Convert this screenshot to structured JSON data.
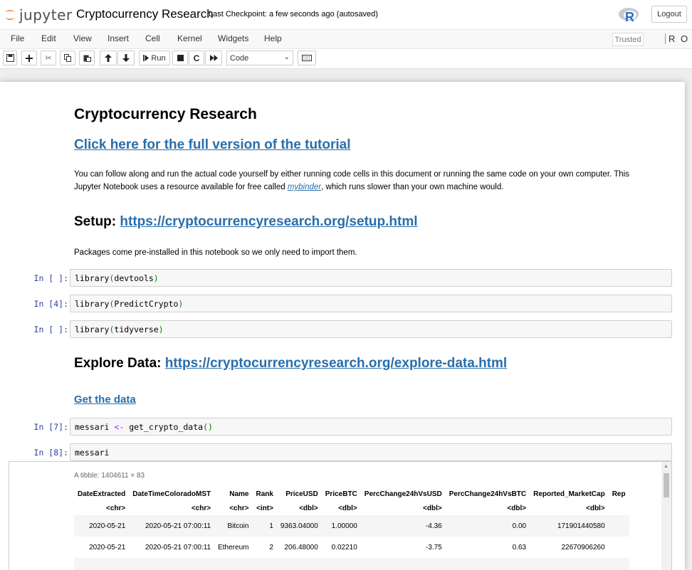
{
  "header": {
    "logo_text": "jupyter",
    "notebook_name": "Cryptocurrency Research",
    "checkpoint": "Last Checkpoint: a few seconds ago  (autosaved)",
    "kernel_logo": "R",
    "logout_label": "Logout"
  },
  "menubar": {
    "items": [
      "File",
      "Edit",
      "View",
      "Insert",
      "Cell",
      "Kernel",
      "Widgets",
      "Help"
    ],
    "trusted_label": "Trusted",
    "kernel_indicator": "R O"
  },
  "toolbar": {
    "run_label": "Run",
    "cell_type": "Code",
    "icons": [
      "save-icon",
      "plus-icon",
      "cut-icon",
      "copy-icon",
      "paste-icon",
      "arrow-up-icon",
      "arrow-down-icon",
      "run-icon",
      "stop-icon",
      "restart-icon",
      "fast-forward-icon",
      "keyboard-icon"
    ]
  },
  "notebook": {
    "title": "Cryptocurrency Research",
    "tutorial_link": "Click here for the full version of the tutorial",
    "intro_text_1": "You can follow along and run the actual code yourself by either running code cells in this document or running the same code on your own computer. This Jupyter Notebook uses a resource available for free called ",
    "intro_link": "mybinder",
    "intro_text_2": ", which runs slower than your own machine would.",
    "setup_heading": "Setup: ",
    "setup_link": "https://cryptocurrencyresearch.org/setup.html",
    "setup_text": "Packages come pre-installed in this notebook so we only need to import them.",
    "cells": [
      {
        "prompt": "In [ ]:",
        "func": "library",
        "arg": "devtools"
      },
      {
        "prompt": "In [4]:",
        "func": "library",
        "arg": "PredictCrypto"
      },
      {
        "prompt": "In [ ]:",
        "func": "library",
        "arg": "tidyverse"
      }
    ],
    "explore_heading": "Explore Data: ",
    "explore_link": "https://cryptocurrencyresearch.org/explore-data.html",
    "get_data_link": "Get the data",
    "cell7": {
      "prompt": "In [7]:",
      "var": "messari",
      "op": "<-",
      "func": "get_crypto_data",
      "parens": "()"
    },
    "cell8": {
      "prompt": "In [8]:",
      "code": "messari"
    }
  },
  "output": {
    "tibble_dims": "A tibble: 1404611 × 83",
    "columns": [
      "DateExtracted",
      "DateTimeColoradoMST",
      "Name",
      "Rank",
      "PriceUSD",
      "PriceBTC",
      "PercChange24hVsUSD",
      "PercChange24hVsBTC",
      "Reported_MarketCap",
      "Rep"
    ],
    "types": [
      "<chr>",
      "<chr>",
      "<chr>",
      "<int>",
      "<dbl>",
      "<dbl>",
      "<dbl>",
      "<dbl>",
      "<dbl>",
      ""
    ],
    "rows": [
      [
        "2020-05-21",
        "2020-05-21 07:00:11",
        "Bitcoin",
        "1",
        "9363.04000",
        "1.00000",
        "-4.36",
        "0.00",
        "171901440580",
        ""
      ],
      [
        "2020-05-21",
        "2020-05-21 07:00:11",
        "Ethereum",
        "2",
        "206.48000",
        "0.02210",
        "-3.75",
        "0.63",
        "22670906260",
        ""
      ]
    ]
  }
}
